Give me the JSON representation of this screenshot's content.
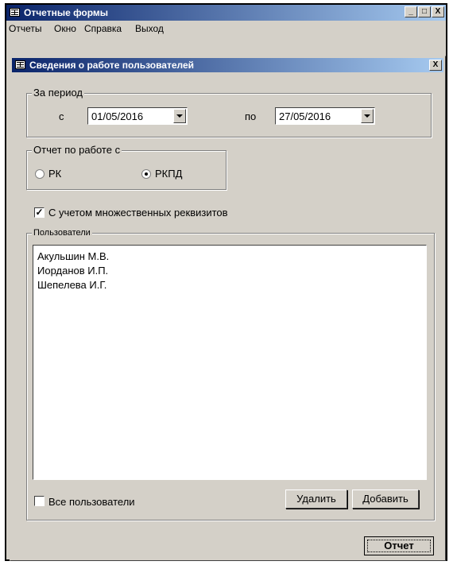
{
  "window": {
    "title": "Отчетные формы",
    "icon": "form-icon"
  },
  "window_controls": {
    "minimize": "_",
    "maximize": "□",
    "close": "X"
  },
  "menu": [
    "Отчеты",
    "Окно",
    "Справка",
    "Выход"
  ],
  "dialog": {
    "title": "Сведения о работе пользователей",
    "close": "X",
    "period": {
      "legend": "За период",
      "from_label": "с",
      "from_value": "01/05/2016",
      "to_label": "по",
      "to_value": "27/05/2016"
    },
    "report_on": {
      "legend": "Отчет по работе с",
      "options": [
        {
          "label": "РК",
          "selected": false
        },
        {
          "label": "РКПД",
          "selected": true
        }
      ]
    },
    "multi_requisites": {
      "label": "С учетом множественных реквизитов",
      "checked": true
    },
    "users": {
      "legend": "Пользователи",
      "items": [
        "Акульшин М.В.",
        "Иорданов И.П.",
        "Шепелева И.Г."
      ],
      "all_users_label": "Все пользователи",
      "all_users_checked": false,
      "delete_label": "Удалить",
      "add_label": "Добавить"
    },
    "report_button": "Отчет"
  }
}
